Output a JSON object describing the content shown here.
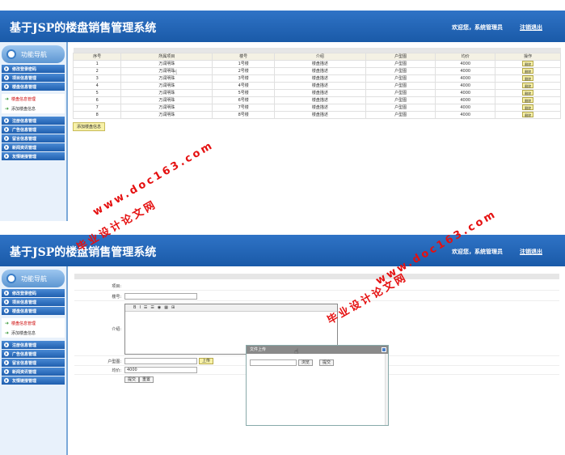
{
  "app": {
    "title": "基于JSP的楼盘销售管理系统",
    "welcome": "欢迎您，系统管理员",
    "logout": "注销退出"
  },
  "sidebar": {
    "nav_title": "功能导航",
    "menus_top": [
      "修改登录密码",
      "项目信息管理",
      "楼盘信息管理"
    ],
    "submenus": [
      "楼盘信息管理",
      "添加楼盘信息"
    ],
    "menus_bottom": [
      "注册信息管理",
      "广告信息管理",
      "留言信息管理",
      "新闻资讯管理",
      "友情链接管理"
    ]
  },
  "list": {
    "headers": [
      "序号",
      "所属项目",
      "楼号",
      "介绍",
      "户型图",
      "均价",
      "操作"
    ],
    "rows": [
      [
        "1",
        "万润明珠",
        "1号楼",
        "楼盘描述",
        "户型图",
        "4000",
        "删除"
      ],
      [
        "2",
        "万润明珠",
        "2号楼",
        "楼盘描述",
        "户型图",
        "4000",
        "删除"
      ],
      [
        "3",
        "万润明珠",
        "3号楼",
        "楼盘描述",
        "户型图",
        "4000",
        "删除"
      ],
      [
        "4",
        "万润明珠",
        "4号楼",
        "楼盘描述",
        "户型图",
        "4000",
        "删除"
      ],
      [
        "5",
        "万润明珠",
        "5号楼",
        "楼盘描述",
        "户型图",
        "4000",
        "删除"
      ],
      [
        "6",
        "万润明珠",
        "6号楼",
        "楼盘描述",
        "户型图",
        "4000",
        "删除"
      ],
      [
        "7",
        "万润明珠",
        "7号楼",
        "楼盘描述",
        "户型图",
        "4000",
        "删除"
      ],
      [
        "8",
        "万润明珠",
        "8号楼",
        "楼盘描述",
        "户型图",
        "4000",
        "删除"
      ]
    ],
    "add_button": "添加楼盘信息"
  },
  "form": {
    "project_label": "项目:",
    "building_label": "楼号:",
    "intro_label": "介绍:",
    "floorplan_label": "户型图:",
    "price_label": "均价:",
    "price_value": "4000",
    "upload_button": "上传",
    "submit_button": "提交",
    "reset_button": "重置",
    "editor_tools": [
      "B",
      "I",
      "☰",
      "☰",
      "◉",
      "▦",
      "⊞"
    ]
  },
  "dialog": {
    "title": "文件上传",
    "browse_button": "浏览",
    "submit_button": "提交"
  },
  "watermark": {
    "site": "www.doc163.com",
    "brand": "毕业设计论文网"
  }
}
